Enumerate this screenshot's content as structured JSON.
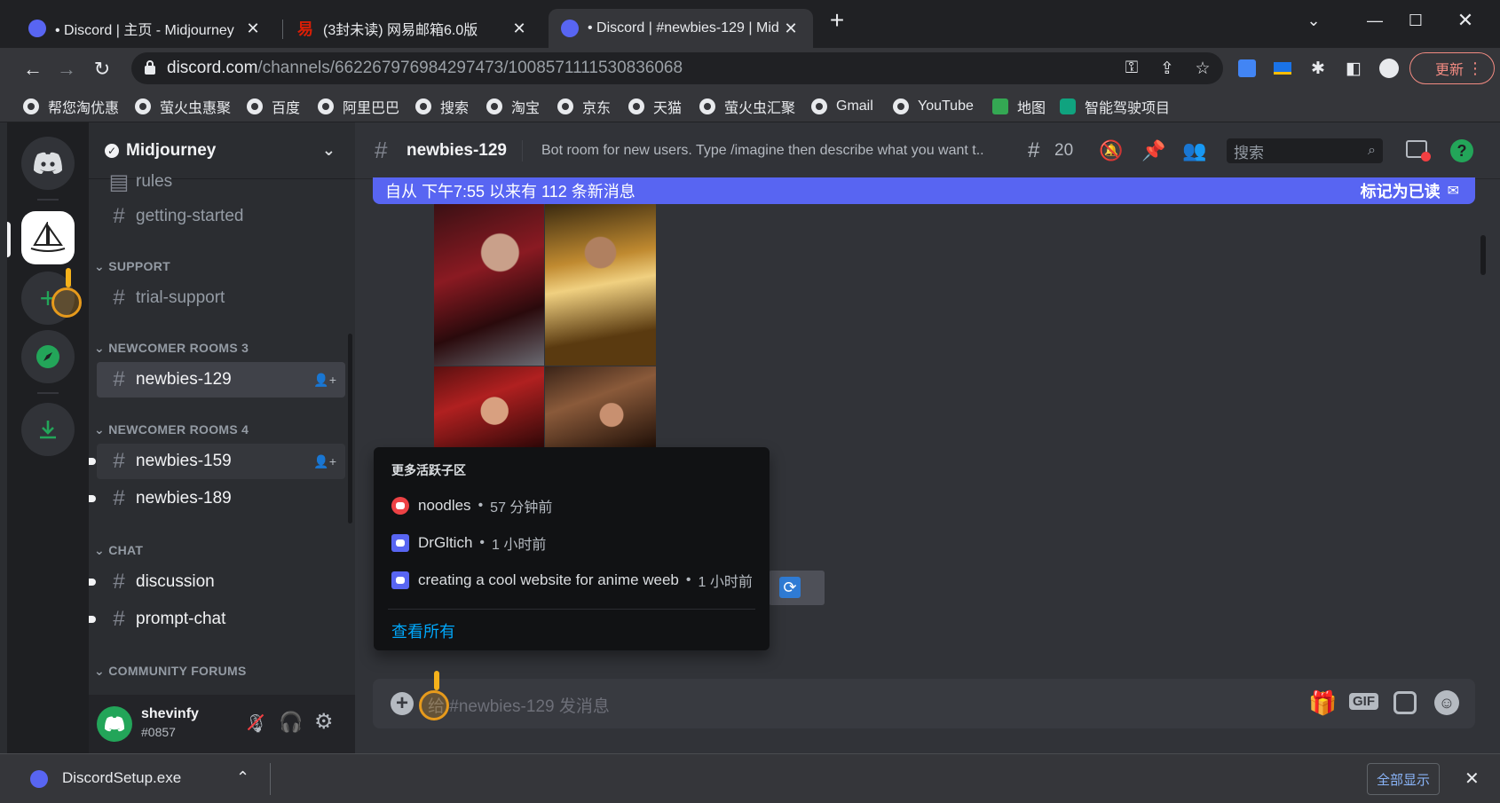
{
  "browser": {
    "tabs": [
      {
        "title": "• Discord | 主页 - Midjourney",
        "active": false,
        "color": "#5865f2"
      },
      {
        "title": "(3封未读) 网易邮箱6.0版",
        "active": false,
        "color": "#d81e06"
      },
      {
        "title": "• Discord | #newbies-129 | Mid",
        "active": true,
        "color": "#5865f2"
      }
    ],
    "new_tab": "+",
    "url_host": "discord.com",
    "url_path": "/channels/662267976984297473/1008571111530836068",
    "update_label": "更新",
    "bookmarks": [
      "帮您淘优惠",
      "萤火虫惠聚",
      "百度",
      "阿里巴巴",
      "搜索",
      "淘宝",
      "京东",
      "天猫",
      "萤火虫汇聚",
      "Gmail",
      "YouTube",
      "地图",
      "智能驾驶项目"
    ]
  },
  "server": {
    "name": "Midjourney",
    "categories": {
      "support": "SUPPORT",
      "newcomer3": "NEWCOMER ROOMS 3",
      "newcomer4": "NEWCOMER ROOMS 4",
      "chat": "CHAT",
      "forums": "COMMUNITY FORUMS"
    },
    "channels": {
      "rules": "rules",
      "getting_started": "getting-started",
      "trial_support": "trial-support",
      "newbies129": "newbies-129",
      "newbies159": "newbies-159",
      "newbies189": "newbies-189",
      "discussion": "discussion",
      "prompt_chat": "prompt-chat"
    }
  },
  "user": {
    "name": "shevinfy",
    "tag": "#0857"
  },
  "channel_header": {
    "name": "newbies-129",
    "topic": "Bot room for new users. Type /imagine then describe what you want t...",
    "threads_count": "20",
    "search_placeholder": "搜索"
  },
  "banner": {
    "text": "自从 下午7:55 以来有 112 条新消息",
    "mark_read": "标记为已读"
  },
  "threads_popup": {
    "title": "更多活跃子区",
    "items": [
      {
        "name": "noodles",
        "time": "57 分钟前",
        "color": "#ed4245"
      },
      {
        "name": "DrGltich",
        "time": "1 小时前",
        "color": "#5865f2"
      },
      {
        "name": "creating a cool website for anime weeb",
        "time": "1 小时前",
        "color": "#5865f2"
      }
    ],
    "see_all": "查看所有"
  },
  "composer": {
    "placeholder": "给 #newbies-129 发消息",
    "gif": "GIF"
  },
  "download": {
    "file": "DiscordSetup.exe",
    "show_all": "全部显示"
  }
}
